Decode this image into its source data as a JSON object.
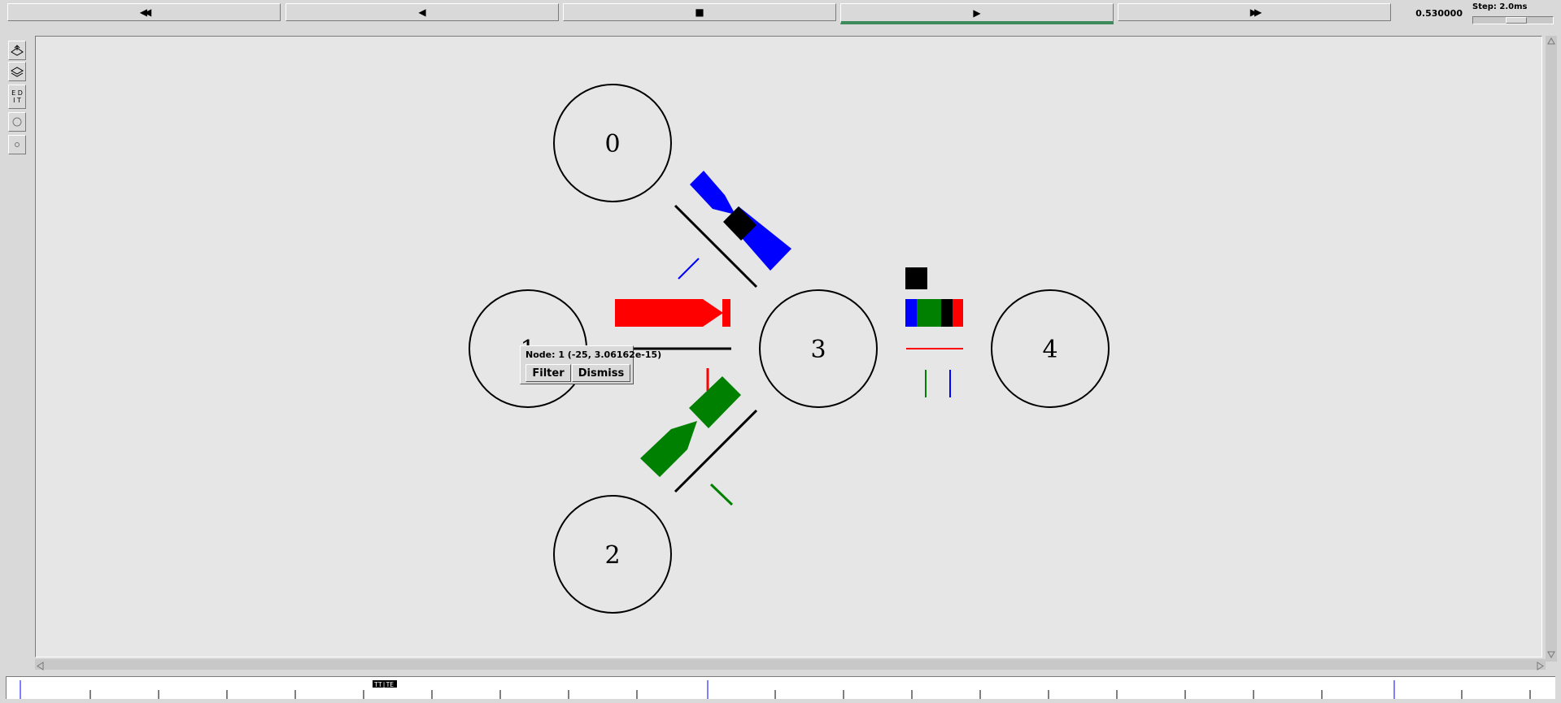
{
  "toolbar": {
    "buttons": [
      {
        "name": "rewind-button",
        "icon": "fast-rewind-icon",
        "glyph": "◀◀"
      },
      {
        "name": "step-back-button",
        "icon": "step-back-icon",
        "glyph": "◀"
      },
      {
        "name": "stop-button",
        "icon": "stop-icon",
        "glyph": "■"
      },
      {
        "name": "play-button",
        "icon": "play-icon",
        "glyph": "▶",
        "active": true
      },
      {
        "name": "fast-forward-button",
        "icon": "fast-forward-icon",
        "glyph": "▶▶"
      }
    ],
    "time": "0.530000",
    "step_label": "Step: 2.0ms"
  },
  "tools": {
    "edit_label": "E D\nI T"
  },
  "nodes": [
    {
      "id": "0",
      "label": "0"
    },
    {
      "id": "1",
      "label": "1"
    },
    {
      "id": "2",
      "label": "2"
    },
    {
      "id": "3",
      "label": "3"
    },
    {
      "id": "4",
      "label": "4"
    }
  ],
  "popup": {
    "title": "Node: 1 (-25, 3.06162e-15)",
    "filter_label": "Filter",
    "dismiss_label": "Dismiss"
  },
  "timeline": {
    "marker_label": "TT|TE"
  },
  "colors": {
    "flow_blue": "#0000ff",
    "flow_red": "#ff0000",
    "flow_green": "#008000",
    "packet_black": "#000000",
    "canvas": "#e6e6e6",
    "play_active": "#3d8a5a"
  }
}
